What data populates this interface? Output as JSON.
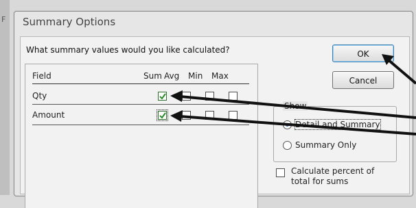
{
  "background": {
    "letter": "F"
  },
  "dialog": {
    "title": "Summary Options",
    "question": "What summary values would you like calculated?",
    "columns": {
      "field": "Field",
      "sum": "Sum",
      "avg": "Avg",
      "min": "Min",
      "max": "Max"
    },
    "rows": [
      {
        "label": "Qty",
        "sum": true,
        "avg": false,
        "min": false,
        "max": false
      },
      {
        "label": "Amount",
        "sum": true,
        "avg": false,
        "min": false,
        "max": false
      }
    ],
    "ok_label": "OK",
    "cancel_label": "Cancel",
    "show": {
      "legend": "Show",
      "detail_summary_label": "Detail and Summary",
      "summary_only_label": "Summary Only",
      "selected": "detail_summary"
    },
    "calc_percent": {
      "line1": "Calculate percent of",
      "line2": "total for sums",
      "checked": false
    }
  },
  "colors": {
    "check": "#2a8a2a",
    "arrow": "#111111",
    "default_button_border": "#3c7fb1"
  }
}
